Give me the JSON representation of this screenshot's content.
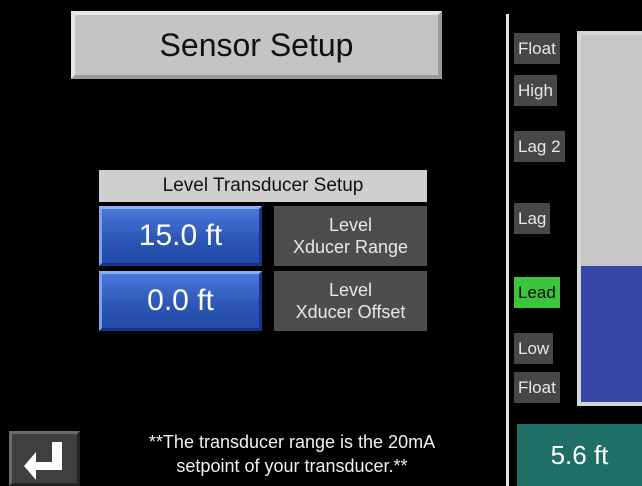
{
  "screen": {
    "title": "Sensor Setup"
  },
  "transducer_setup": {
    "header": "Level Transducer Setup",
    "range": {
      "value": "15.0 ft",
      "label_line1": "Level",
      "label_line2": "Xducer Range"
    },
    "offset": {
      "value": "0.0 ft",
      "label_line1": "Level",
      "label_line2": "Xducer Offset"
    }
  },
  "note": {
    "line1": "**The transducer range is the 20mA",
    "line2": "setpoint of your transducer.**"
  },
  "back_button": {
    "icon": "return-arrow-icon"
  },
  "level_indicator": {
    "labels": {
      "float_high": "Float",
      "high": "High",
      "lag2": "Lag 2",
      "lag": "Lag",
      "lead": "Lead",
      "low": "Low",
      "float_low": "Float"
    },
    "active_label": "Lead",
    "fill_fraction": 0.37,
    "readout": "5.6 ft"
  },
  "colors": {
    "background": "#000000",
    "button_blue": "#2c57b8",
    "label_gray": "#4d4d4d",
    "active_green": "#3cc43c",
    "tank_fill": "#3546a6",
    "tank_empty": "#c6c6c6",
    "readout_teal": "#1f6f66"
  }
}
